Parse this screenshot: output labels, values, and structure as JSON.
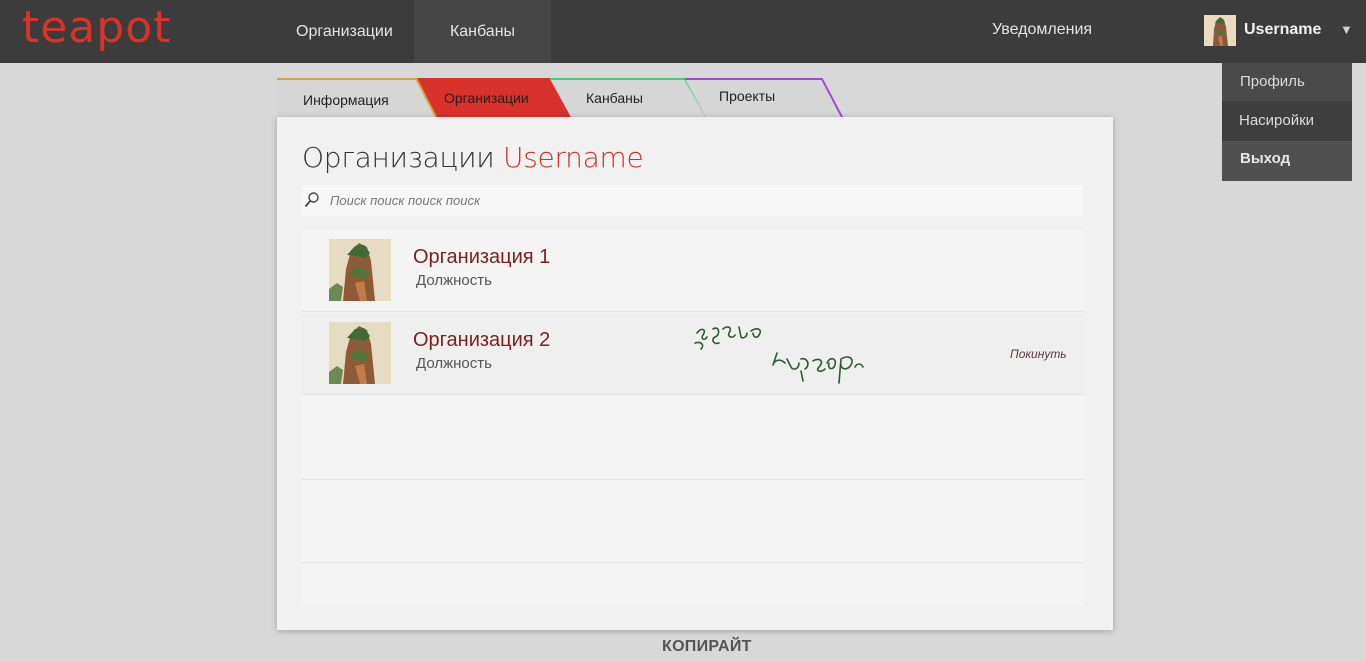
{
  "app": {
    "logo": "teapot"
  },
  "nav": {
    "items": [
      {
        "label": "Организации"
      },
      {
        "label": "Канбаны"
      }
    ],
    "notifications": "Уведомления"
  },
  "user": {
    "name": "Username",
    "caret": "▼"
  },
  "dropdown": {
    "items": [
      {
        "label": "Профиль"
      },
      {
        "label": "Насиройки"
      },
      {
        "label": "Выход"
      }
    ]
  },
  "tabs": [
    {
      "label": "Информация"
    },
    {
      "label": "Организации"
    },
    {
      "label": "Канбаны"
    },
    {
      "label": "Проекты"
    }
  ],
  "page": {
    "title": "Организации",
    "title_user": "Username"
  },
  "search": {
    "placeholder": "Поиск поиск поиск поиск"
  },
  "organizations": [
    {
      "name": "Организация 1",
      "role": "Должность"
    },
    {
      "name": "Организация 2",
      "role": "Должность",
      "action": "Покинуть"
    }
  ],
  "footer": {
    "text": "КОПИРАЙТ"
  },
  "colors": {
    "accent": "#d4302a",
    "topbar": "#3c3c3c",
    "org_name": "#7a1f1f",
    "tab_info": "#d7a13c",
    "tab_kanban": "#3fd07a",
    "tab_projects": "#a24ad8"
  }
}
